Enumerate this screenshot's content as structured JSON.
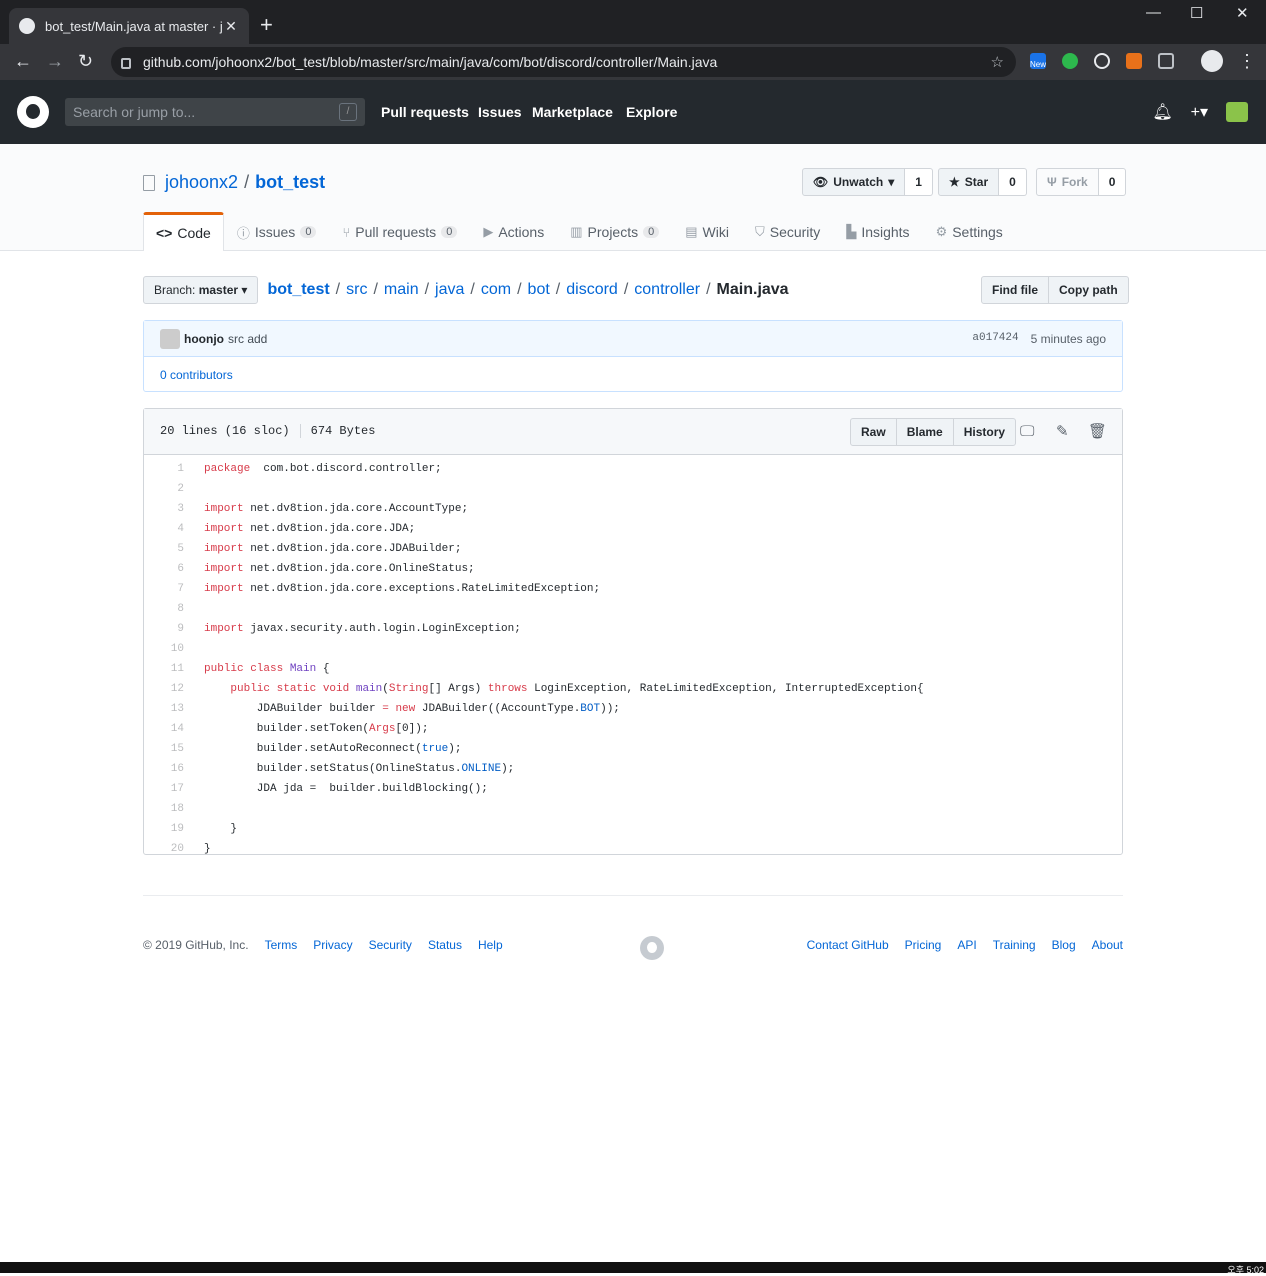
{
  "browser": {
    "tab_title": "bot_test/Main.java at master · jo",
    "url": "github.com/johoonx2/bot_test/blob/master/src/main/java/com/bot/discord/controller/Main.java",
    "new_badge": "New"
  },
  "gh": {
    "search_placeholder": "Search or jump to...",
    "search_key": "/",
    "nav": [
      "Pull requests",
      "Issues",
      "Marketplace",
      "Explore"
    ]
  },
  "repo": {
    "owner": "johoonx2",
    "name": "bot_test",
    "watch_label": "Unwatch",
    "watch_count": "1",
    "star_label": "Star",
    "star_count": "0",
    "fork_label": "Fork",
    "fork_count": "0"
  },
  "tabs": [
    {
      "label": "Code",
      "count": ""
    },
    {
      "label": "Issues",
      "count": "0"
    },
    {
      "label": "Pull requests",
      "count": "0"
    },
    {
      "label": "Actions",
      "count": ""
    },
    {
      "label": "Projects",
      "count": "0"
    },
    {
      "label": "Wiki",
      "count": ""
    },
    {
      "label": "Security",
      "count": ""
    },
    {
      "label": "Insights",
      "count": ""
    },
    {
      "label": "Settings",
      "count": ""
    }
  ],
  "branch": {
    "prefix": "Branch:",
    "name": "master"
  },
  "path": [
    "bot_test",
    "src",
    "main",
    "java",
    "com",
    "bot",
    "discord",
    "controller"
  ],
  "filename": "Main.java",
  "file_buttons": {
    "find": "Find file",
    "copy": "Copy path"
  },
  "commit": {
    "author": "hoonjo",
    "message": "src add",
    "sha": "a017424",
    "time": "5 minutes ago",
    "contributors": "0 contributors"
  },
  "file": {
    "lines": "20 lines (16 sloc)",
    "size": "674 Bytes",
    "raw": "Raw",
    "blame": "Blame",
    "history": "History"
  },
  "code": [
    [
      [
        "k",
        "package"
      ],
      [
        "",
        "  com.bot.discord.controller;"
      ]
    ],
    [],
    [
      [
        "k",
        "import"
      ],
      [
        "",
        " net.dv8tion.jda.core.AccountType;"
      ]
    ],
    [
      [
        "k",
        "import"
      ],
      [
        "",
        " net.dv8tion.jda.core.JDA;"
      ]
    ],
    [
      [
        "k",
        "import"
      ],
      [
        "",
        " net.dv8tion.jda.core.JDABuilder;"
      ]
    ],
    [
      [
        "k",
        "import"
      ],
      [
        "",
        " net.dv8tion.jda.core.OnlineStatus;"
      ]
    ],
    [
      [
        "k",
        "import"
      ],
      [
        "",
        " net.dv8tion.jda.core.exceptions.RateLimitedException;"
      ]
    ],
    [],
    [
      [
        "k",
        "import"
      ],
      [
        "",
        " javax.security.auth.login.LoginException;"
      ]
    ],
    [],
    [
      [
        "k",
        "public class"
      ],
      [
        "",
        " "
      ],
      [
        "e",
        "Main"
      ],
      [
        "",
        " {"
      ]
    ],
    [
      [
        "",
        "    "
      ],
      [
        "k",
        "public static void"
      ],
      [
        "",
        " "
      ],
      [
        "e",
        "main"
      ],
      [
        "",
        "("
      ],
      [
        "k",
        "String"
      ],
      [
        "",
        "[] Args) "
      ],
      [
        "k",
        "throws"
      ],
      [
        "",
        " LoginException, RateLimitedException, InterruptedException{"
      ]
    ],
    [
      [
        "",
        "        JDABuilder builder "
      ],
      [
        "k",
        "="
      ],
      [
        "",
        " "
      ],
      [
        "k",
        "new"
      ],
      [
        "",
        " JDABuilder((AccountType."
      ],
      [
        "c1",
        "BOT"
      ],
      [
        "",
        "));"
      ]
    ],
    [
      [
        "",
        "        builder.setToken("
      ],
      [
        "k",
        "Args"
      ],
      [
        "",
        "[0]);"
      ]
    ],
    [
      [
        "",
        "        builder.setAutoReconnect("
      ],
      [
        "c1",
        "true"
      ],
      [
        "",
        "); "
      ]
    ],
    [
      [
        "",
        "        builder.setStatus(OnlineStatus."
      ],
      [
        "c1",
        "ONLINE"
      ],
      [
        "",
        "); "
      ]
    ],
    [
      [
        "",
        "        JDA jda =  builder.buildBlocking();"
      ]
    ],
    [],
    [
      [
        "",
        "    }"
      ]
    ],
    [
      [
        "",
        "}"
      ]
    ]
  ],
  "footer": {
    "copyright": "© 2019 GitHub, Inc.",
    "left_links": [
      "Terms",
      "Privacy",
      "Security",
      "Status",
      "Help"
    ],
    "right_links": [
      "Contact GitHub",
      "Pricing",
      "API",
      "Training",
      "Blog",
      "About"
    ]
  },
  "taskbar": {
    "clock": "오후 5:02"
  }
}
